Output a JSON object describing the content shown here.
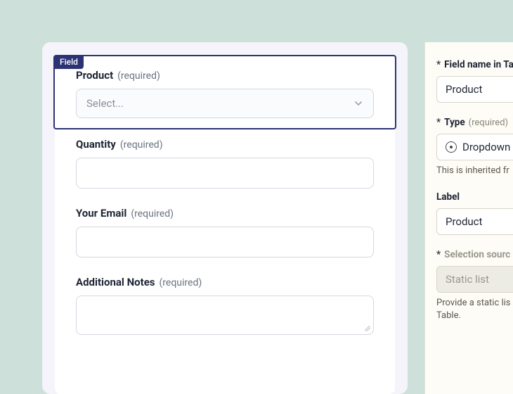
{
  "form": {
    "badge": "Field",
    "required_label": "(required)",
    "fields": [
      {
        "label": "Product",
        "type": "select",
        "placeholder": "Select..."
      },
      {
        "label": "Quantity",
        "type": "text"
      },
      {
        "label": "Your Email",
        "type": "text"
      },
      {
        "label": "Additional Notes",
        "type": "textarea"
      }
    ]
  },
  "sidebar": {
    "field_name": {
      "label": "Field name in Ta",
      "value": "Product"
    },
    "type": {
      "label": "Type",
      "req": "(required)",
      "value": "Dropdown",
      "help": "This is inherited fr"
    },
    "label_field": {
      "label": "Label",
      "value": "Product"
    },
    "selection_source": {
      "label": "Selection sourc",
      "value": "Static list",
      "help": "Provide a static lis",
      "help2": "Table."
    }
  },
  "asterisk": "*"
}
